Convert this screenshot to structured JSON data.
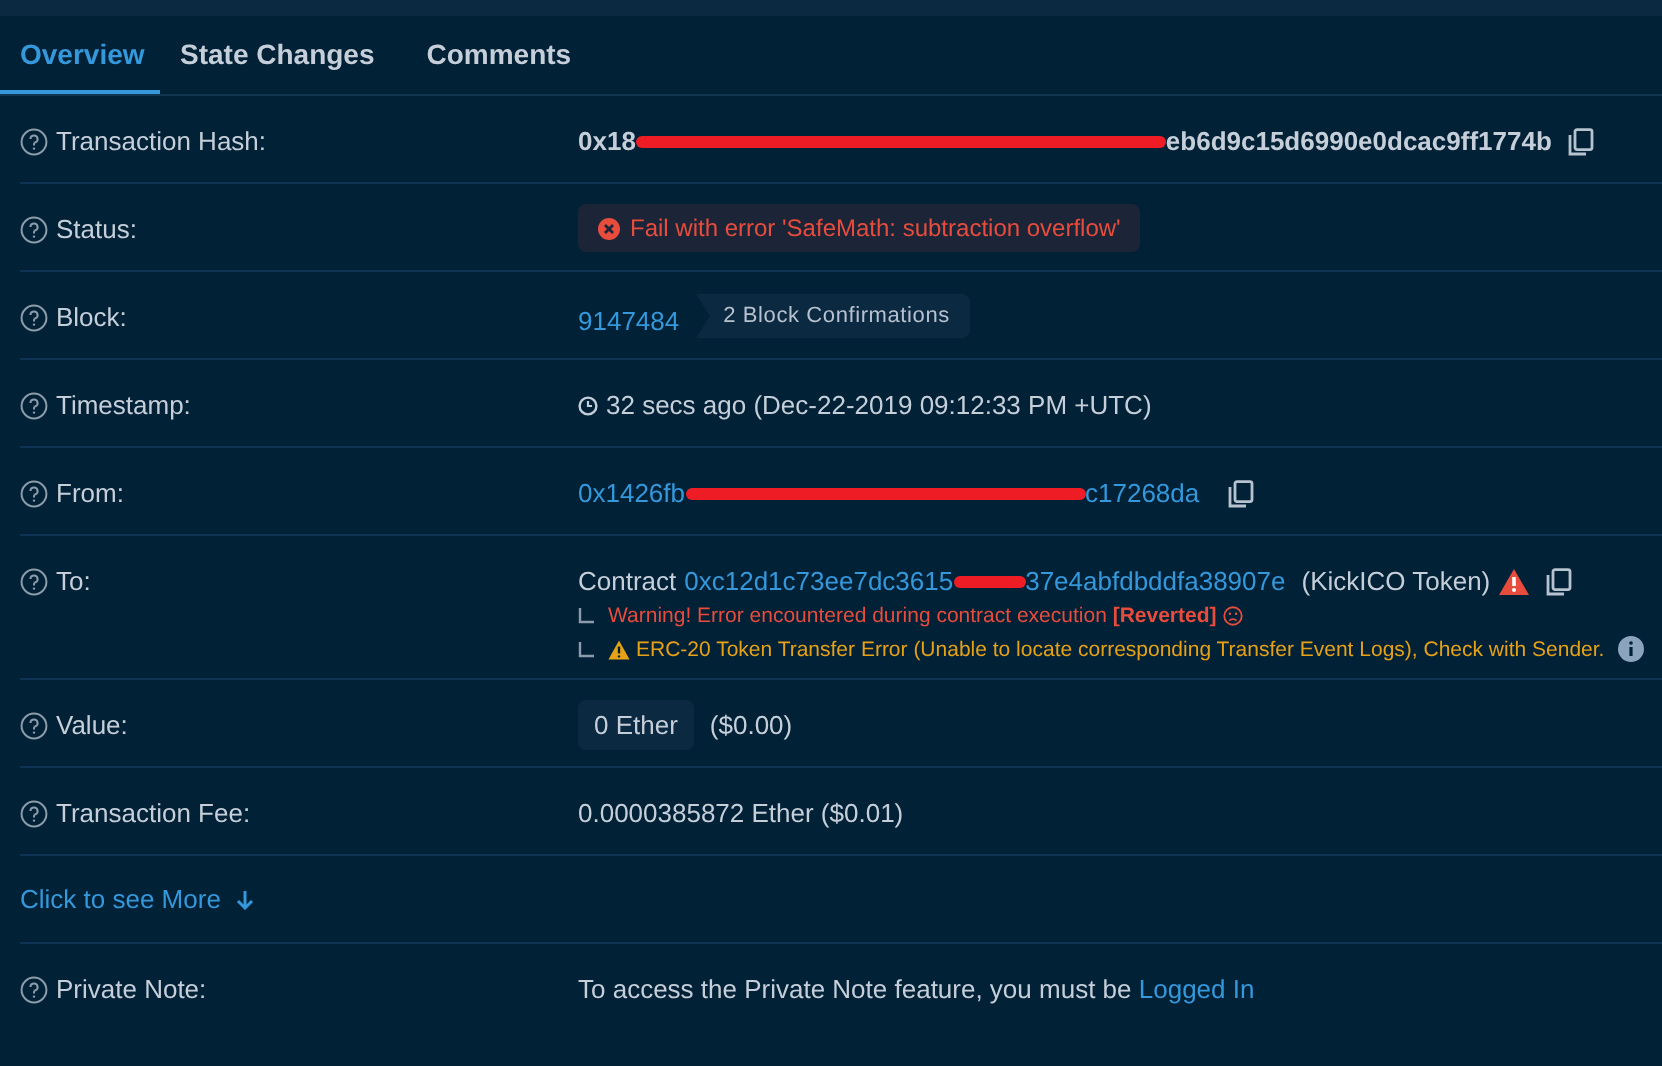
{
  "tabs": [
    {
      "label": "Overview",
      "selected": true
    },
    {
      "label": "State Changes",
      "selected": false
    },
    {
      "label": "Comments",
      "selected": false
    }
  ],
  "rows": [
    {
      "kind": "hash",
      "label": "Transaction Hash:",
      "value_start": "0x18",
      "value_end": "eb6d9c15d6990e0dcac9ff1774b",
      "redacted": true
    },
    {
      "kind": "status",
      "label": "Status:",
      "badge": "Fail with error 'SafeMath: subtraction overflow'"
    },
    {
      "kind": "block",
      "label": "Block:",
      "block": "9147484",
      "confirmations": "2 Block Confirmations"
    },
    {
      "kind": "timestamp",
      "label": "Timestamp:",
      "value": "32 secs ago (Dec-22-2019 09:12:33 PM +UTC)"
    },
    {
      "kind": "address",
      "label": "From:",
      "value_start": "0x1426fb",
      "value_end": "c17268da",
      "redacted": true
    },
    {
      "kind": "to",
      "label": "To:",
      "prefix": "Contract",
      "value_start": "0xc12d1c73ee7dc3615",
      "value_end": "37e4abfdbddfa38907e",
      "redacted": true,
      "token": "(KickICO Token)",
      "warning": "Warning! Error encountered during contract execution **[Reverted]**",
      "transfer_error": "ERC-20 Token Transfer Error (Unable to locate corresponding Transfer Event Logs), Check with Sender."
    },
    {
      "kind": "value",
      "label": "Value:",
      "amount": "0 Ether",
      "fiat": "($0.00)"
    },
    {
      "kind": "plain",
      "label": "Transaction Fee:",
      "value": "0.0000385872 Ether ($0.01)"
    },
    {
      "kind": "more",
      "link": "Click to see More"
    },
    {
      "kind": "note",
      "label": "Private Note:",
      "text": "To access the Private Note feature, you must be",
      "link": "Logged In"
    }
  ]
}
